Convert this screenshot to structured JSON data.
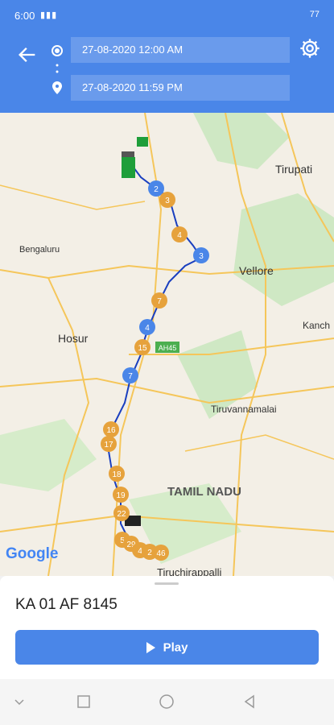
{
  "status_bar": {
    "time": "6:00",
    "signal": "▮▮▮",
    "battery": "77"
  },
  "header": {
    "start_datetime": "27-08-2020 12:00 AM",
    "end_datetime": "27-08-2020 11:59 PM"
  },
  "map": {
    "labels": [
      "Tirupati",
      "Bengaluru",
      "Vellore",
      "Hosur",
      "Kanch",
      "Tiruvannamalai",
      "TAMIL NADU",
      "Tiruchirappalli",
      "AH45"
    ],
    "attribution": "Google",
    "markers": [
      "2",
      "3",
      "4",
      "3",
      "7",
      "4",
      "15",
      "7",
      "16",
      "17",
      "18",
      "19",
      "22",
      "5",
      "29",
      "4",
      "2",
      "46"
    ]
  },
  "vehicle": {
    "number": "KA 01 AF 8145"
  },
  "play_button": {
    "label": "Play"
  },
  "colors": {
    "primary": "#4a86e8",
    "marker_orange": "#e6a23c",
    "marker_blue": "#4a86e8"
  }
}
